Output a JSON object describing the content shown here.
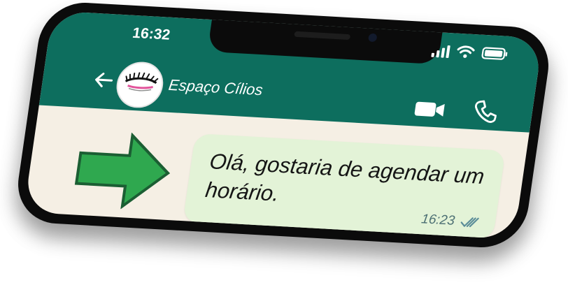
{
  "status_bar": {
    "time": "16:32",
    "signal_icon": "signal-bars-icon",
    "wifi_icon": "wifi-icon",
    "battery_icon": "battery-icon"
  },
  "header": {
    "back_icon": "arrow-left-icon",
    "contact_name": "Espaço Cílios",
    "avatar_icon": "eyelash-avatar-icon",
    "video_icon": "video-camera-icon",
    "call_icon": "phone-icon"
  },
  "chat": {
    "arrow_icon": "green-arrow-right-icon",
    "message": {
      "text": "Olá, gostaria de agendar um horário.",
      "time": "16:23",
      "status_icon": "double-check-icon"
    }
  },
  "colors": {
    "header": "#0d6e5e",
    "chat_background": "#f5efe4",
    "bubble": "#e3f3d7",
    "arrow": "#2fa84f",
    "check_marks": "#5a8c98"
  }
}
